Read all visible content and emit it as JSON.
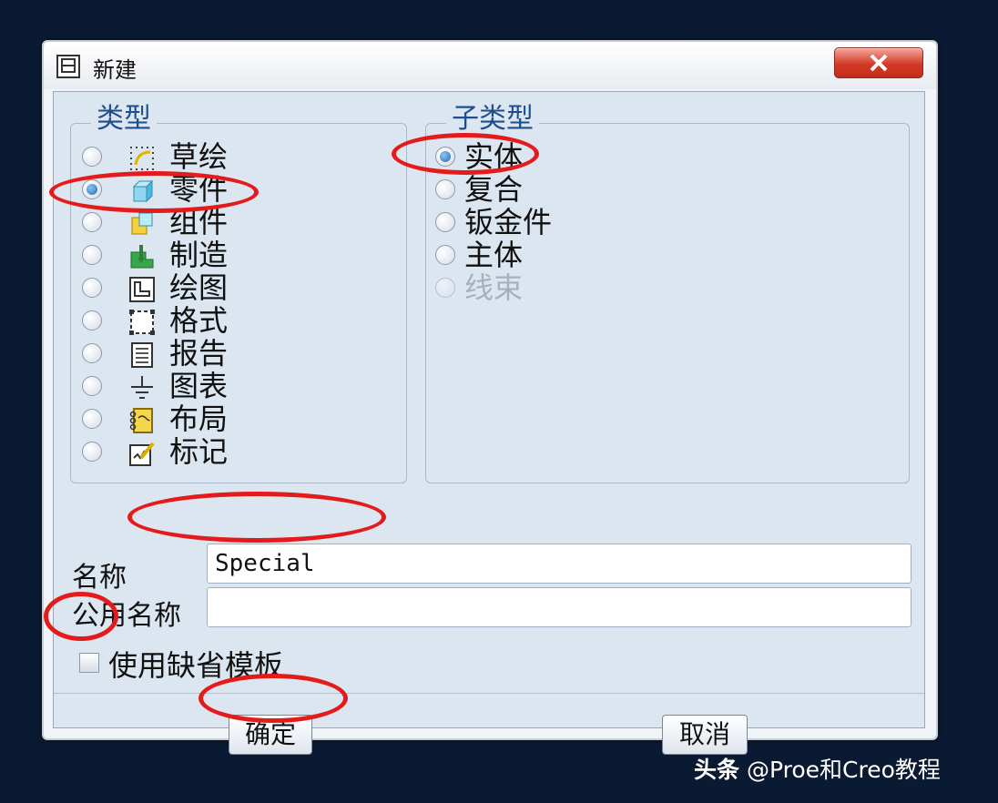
{
  "window": {
    "title": "新建"
  },
  "type_group": {
    "legend": "类型",
    "options": [
      {
        "label": "草绘",
        "icon": "sketch-icon",
        "checked": false,
        "disabled": false
      },
      {
        "label": "零件",
        "icon": "part-icon",
        "checked": true,
        "disabled": false
      },
      {
        "label": "组件",
        "icon": "assembly-icon",
        "checked": false,
        "disabled": false
      },
      {
        "label": "制造",
        "icon": "manufacturing-icon",
        "checked": false,
        "disabled": false
      },
      {
        "label": "绘图",
        "icon": "drawing-icon",
        "checked": false,
        "disabled": false
      },
      {
        "label": "格式",
        "icon": "format-icon",
        "checked": false,
        "disabled": false
      },
      {
        "label": "报告",
        "icon": "report-icon",
        "checked": false,
        "disabled": false
      },
      {
        "label": "图表",
        "icon": "diagram-icon",
        "checked": false,
        "disabled": false
      },
      {
        "label": "布局",
        "icon": "layout-icon",
        "checked": false,
        "disabled": false
      },
      {
        "label": "标记",
        "icon": "markup-icon",
        "checked": false,
        "disabled": false
      }
    ]
  },
  "subtype_group": {
    "legend": "子类型",
    "options": [
      {
        "label": "实体",
        "checked": true,
        "disabled": false
      },
      {
        "label": "复合",
        "checked": false,
        "disabled": false
      },
      {
        "label": "钣金件",
        "checked": false,
        "disabled": false
      },
      {
        "label": "主体",
        "checked": false,
        "disabled": false
      },
      {
        "label": "线束",
        "checked": false,
        "disabled": true
      }
    ]
  },
  "name_field": {
    "label": "名称",
    "value": "Special"
  },
  "common_name_field": {
    "label": "公用名称",
    "value": ""
  },
  "default_template": {
    "label": "使用缺省模板",
    "checked": false
  },
  "buttons": {
    "ok": "确定",
    "cancel": "取消"
  },
  "watermark": {
    "brand": "头条",
    "text": "@Proe和Creo教程"
  },
  "colors": {
    "annotation": "#e41b1b",
    "legend": "#1e4e8c",
    "background": "#0b1a33"
  }
}
